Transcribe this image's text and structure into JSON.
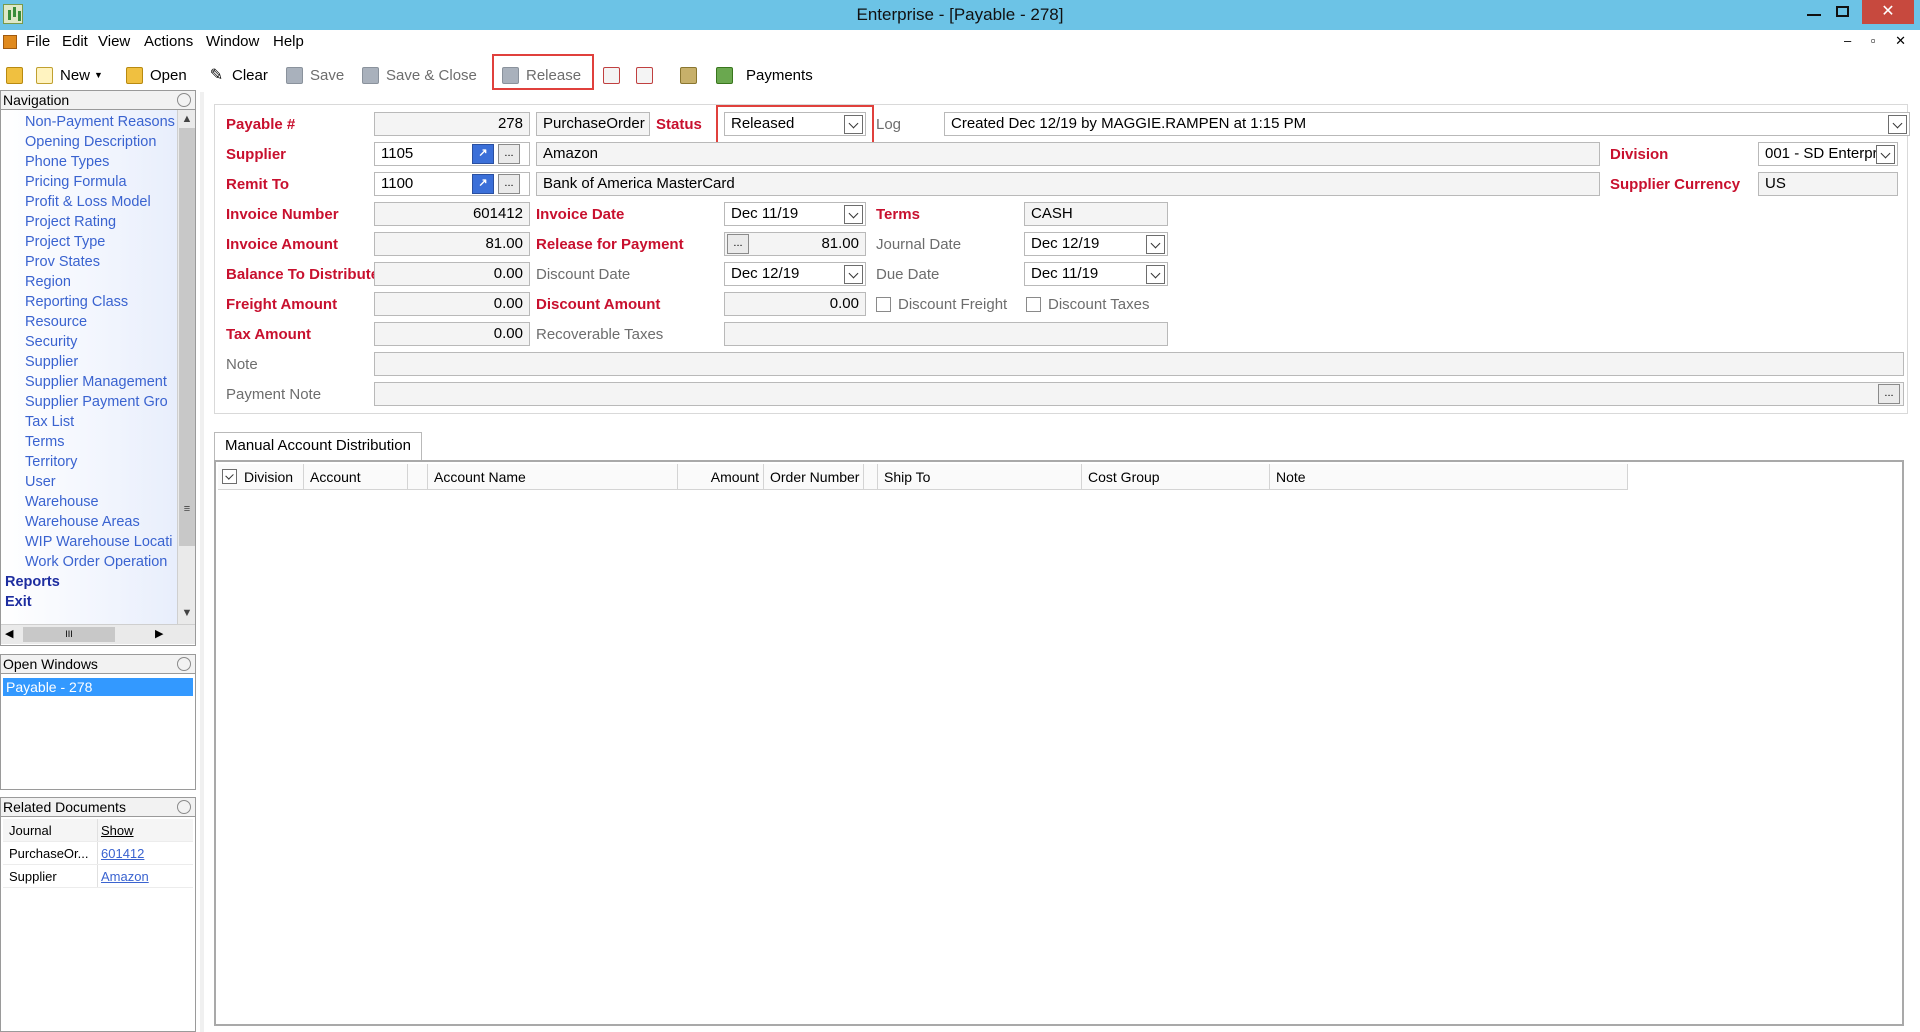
{
  "window": {
    "title": "Enterprise - [Payable - 278]",
    "controls": {
      "minimize": "–",
      "close": "✕"
    }
  },
  "menu": {
    "items": [
      "File",
      "Edit",
      "View",
      "Actions",
      "Window",
      "Help"
    ],
    "mdi_controls": "– ▫ ✕"
  },
  "toolbar": {
    "new_label": "New",
    "open_label": "Open",
    "clear_label": "Clear",
    "save_label": "Save",
    "save_close_label": "Save & Close",
    "release_label": "Release",
    "payments_label": "Payments"
  },
  "navigation": {
    "header": "Navigation",
    "items": [
      "Non-Payment Reasons",
      "Opening Description",
      "Phone Types",
      "Pricing Formula",
      "Profit & Loss Model",
      "Project Rating",
      "Project Type",
      "Prov States",
      "Region",
      "Reporting Class",
      "Resource",
      "Security",
      "Supplier",
      "Supplier Management",
      "Supplier Payment Gro",
      "Tax List",
      "Terms",
      "Territory",
      "User",
      "Warehouse",
      "Warehouse Areas",
      "WIP Warehouse Locati",
      "Work Order Operation"
    ],
    "reports": "Reports",
    "exit": "Exit",
    "hscroll_grip": "III",
    "vscroll_grip": "≡"
  },
  "open_windows": {
    "header": "Open Windows",
    "items": [
      "Payable - 278"
    ]
  },
  "related_documents": {
    "header": "Related Documents",
    "col_journal": "Journal",
    "col_show": "Show",
    "rows": [
      {
        "journal": "PurchaseOr...",
        "show": "601412"
      },
      {
        "journal": "Supplier",
        "show": "Amazon"
      }
    ]
  },
  "form": {
    "payable_label": "Payable #",
    "payable_value": "278",
    "source_type": "PurchaseOrder",
    "status_label": "Status",
    "status_value": "Released",
    "log_label": "Log",
    "log_value": "Created Dec 12/19 by MAGGIE.RAMPEN at 1:15 PM",
    "supplier_label": "Supplier",
    "supplier_code": "1105",
    "supplier_name": "Amazon",
    "division_label": "Division",
    "division_value": "001 - SD Enterpr",
    "remit_label": "Remit To",
    "remit_code": "1100",
    "remit_name": "Bank of America MasterCard",
    "supplier_currency_label": "Supplier Currency",
    "supplier_currency_value": "US",
    "invoice_number_label": "Invoice Number",
    "invoice_number_value": "601412",
    "invoice_date_label": "Invoice Date",
    "invoice_date_value": "Dec 11/19",
    "terms_label": "Terms",
    "terms_value": "CASH",
    "invoice_amount_label": "Invoice Amount",
    "invoice_amount_value": "81.00",
    "release_payment_label": "Release for Payment",
    "release_payment_value": "81.00",
    "journal_date_label": "Journal Date",
    "journal_date_value": "Dec 12/19",
    "balance_label": "Balance To Distribute",
    "balance_value": "0.00",
    "discount_date_label": "Discount Date",
    "discount_date_value": "Dec 12/19",
    "due_date_label": "Due Date",
    "due_date_value": "Dec 11/19",
    "freight_label": "Freight Amount",
    "freight_value": "0.00",
    "discount_amount_label": "Discount Amount",
    "discount_amount_value": "0.00",
    "discount_freight_label": "Discount Freight",
    "discount_taxes_label": "Discount Taxes",
    "tax_label": "Tax Amount",
    "tax_value": "0.00",
    "recoverable_label": "Recoverable Taxes",
    "recoverable_value": "",
    "note_label": "Note",
    "note_value": "",
    "payment_note_label": "Payment Note",
    "payment_note_value": "",
    "ellipsis": "...",
    "lookup": "↗"
  },
  "distribution": {
    "tab_label": "Manual Account Distribution",
    "columns": [
      "Division",
      "Account",
      "Account Name",
      "Amount",
      "Order Number",
      "Ship To",
      "Cost Group",
      "Note"
    ],
    "rows": []
  },
  "colors": {
    "titlebar": "#6cc3e6",
    "required_label": "#c8102e",
    "nav_link": "#3a63d0",
    "selection": "#3399ff",
    "highlight_box": "#e0403c"
  }
}
